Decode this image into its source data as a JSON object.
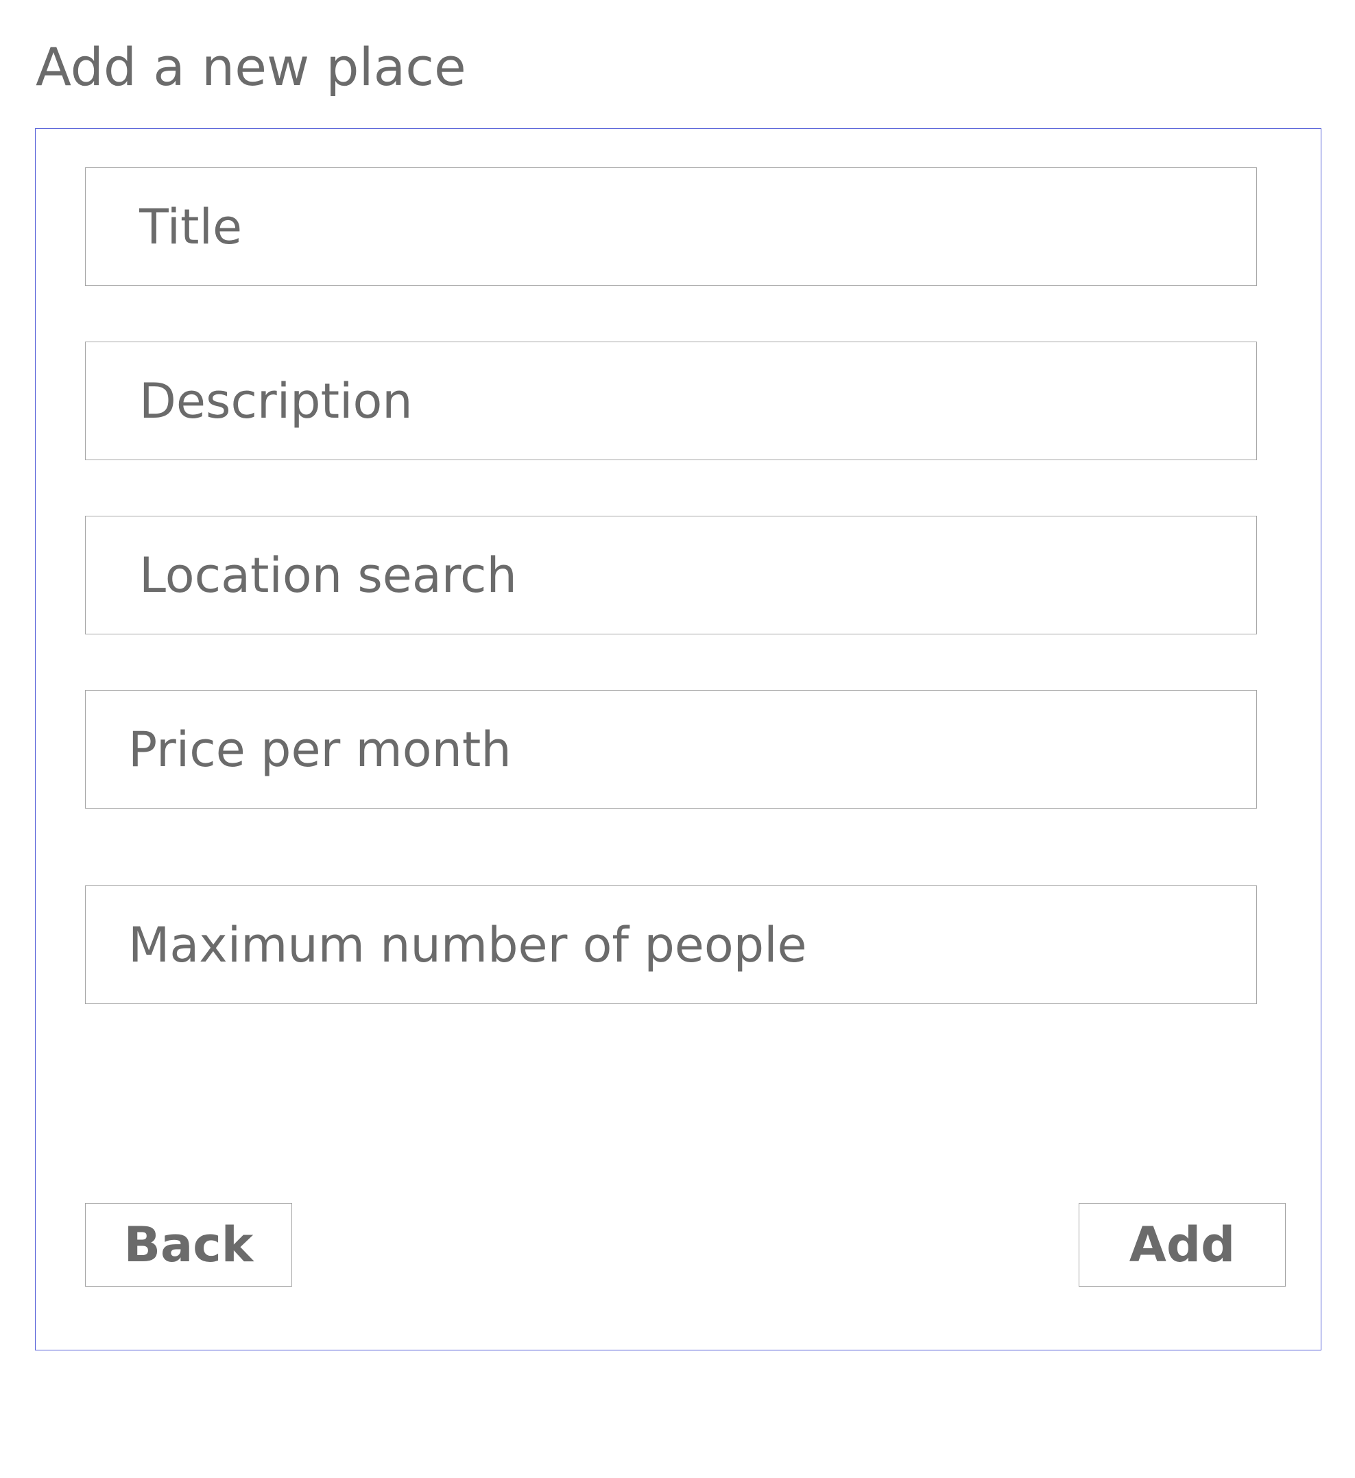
{
  "page": {
    "title": "Add a new place"
  },
  "form": {
    "fields": [
      {
        "name": "title",
        "placeholder": "Title",
        "value": ""
      },
      {
        "name": "description",
        "placeholder": "Description",
        "value": ""
      },
      {
        "name": "location",
        "placeholder": "Location search",
        "value": ""
      },
      {
        "name": "price",
        "placeholder": "Price per month",
        "value": ""
      },
      {
        "name": "max_people",
        "placeholder": "Maximum number of people",
        "value": ""
      }
    ],
    "back_label": "Back",
    "add_label": "Add"
  },
  "colors": {
    "panel_border": "#5560d8",
    "field_border": "#a6a6a6",
    "text": "#6b6b6b"
  }
}
